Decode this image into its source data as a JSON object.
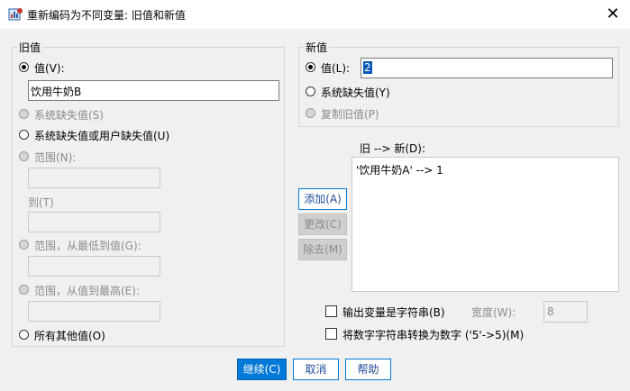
{
  "window": {
    "title": "重新编码为不同变量: 旧值和新值",
    "close_label": "✕"
  },
  "old_value": {
    "legend": "旧值",
    "value_label": "值(V):",
    "value_input": "饮用牛奶B",
    "system_missing": "系统缺失值(S)",
    "system_or_user_missing": "系统缺失值或用户缺失值(U)",
    "range": "范围(N):",
    "to": "到(T)",
    "range_lowest": "范围，从最低到值(G):",
    "range_highest": "范围，从值到最高(E):",
    "all_other": "所有其他值(O)"
  },
  "new_value": {
    "legend": "新值",
    "value_label": "值(L):",
    "value_input": "2",
    "system_missing": "系统缺失值(Y)",
    "copy_old": "复制旧值(P)"
  },
  "mapping": {
    "label": "旧 --> 新(D):",
    "items": [
      "'饮用牛奶A' --> 1"
    ],
    "add": "添加(A)",
    "change": "更改(C)",
    "remove": "除去(M)"
  },
  "options": {
    "output_string": "输出变量是字符串(B)",
    "width_label": "宽度(W):",
    "width_value": "8",
    "convert_numeric": "将数字字符串转换为数字 ('5'->5)(M)"
  },
  "footer": {
    "continue": "继续(C)",
    "cancel": "取消",
    "help": "帮助"
  },
  "colors": {
    "accent": "#0078d7"
  }
}
